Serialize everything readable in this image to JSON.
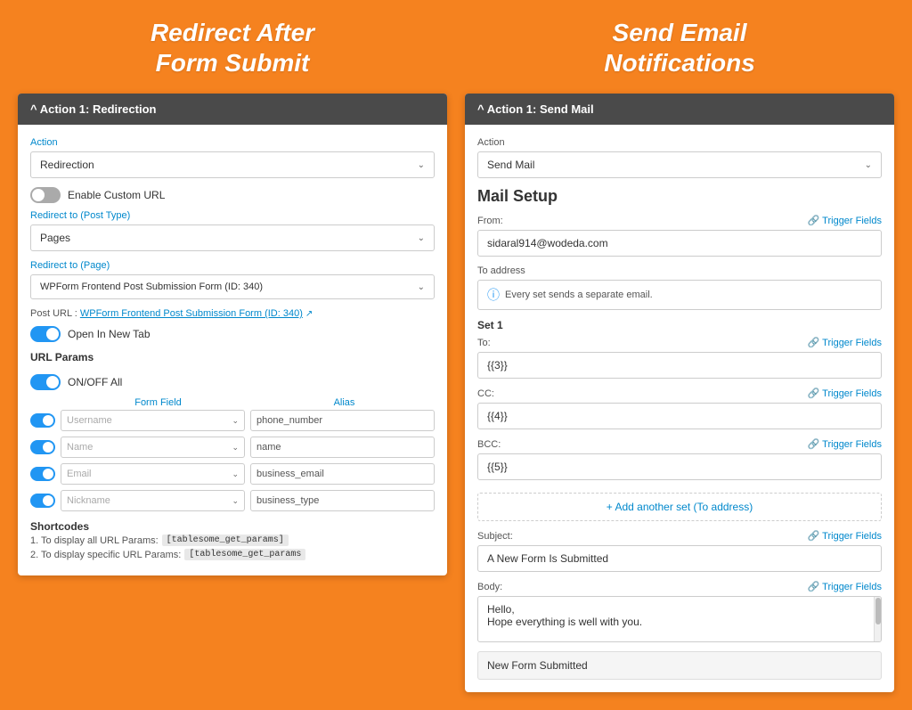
{
  "left": {
    "title_line1": "Redirect After",
    "title_line2": "Form Submit",
    "card_header": "^ Action 1: Redirection",
    "action_label": "Action",
    "action_value": "Redirection",
    "enable_custom_url": "Enable Custom URL",
    "redirect_to_post_type_label": "Redirect to (Post Type)",
    "redirect_to_post_type_value": "Pages",
    "redirect_to_page_label": "Redirect to (Page)",
    "redirect_to_page_value": "WPForm Frontend Post Submission Form (ID: 340)",
    "post_url_label": "Post URL : ",
    "post_url_link": "WPForm Frontend Post Submission Form (ID: 340)",
    "open_in_new_tab": "Open In New Tab",
    "url_params": "URL Params",
    "on_off_all": "ON/OFF All",
    "form_field_header": "Form Field",
    "alias_header": "Alias",
    "rows": [
      {
        "field": "Username",
        "alias": "phone_number",
        "on": true
      },
      {
        "field": "Name",
        "alias": "name",
        "on": true
      },
      {
        "field": "Email",
        "alias": "business_email",
        "on": true
      },
      {
        "field": "Nickname",
        "alias": "business_type",
        "on": true
      }
    ],
    "shortcodes_title": "Shortcodes",
    "shortcodes": [
      {
        "num": "1",
        "text": "To display all URL Params:",
        "code": "[tablesome_get_params]"
      },
      {
        "num": "2",
        "text": "To display specific URL Params:",
        "code": "[tablesome_get_params"
      }
    ]
  },
  "right": {
    "title_line1": "Send Email",
    "title_line2": "Notifications",
    "card_header": "^ Action 1: Send Mail",
    "action_label": "Action",
    "action_value": "Send Mail",
    "mail_setup": "Mail Setup",
    "from_label": "From:",
    "from_value": "sidaral914@wodeda.com",
    "trigger_fields": "Trigger Fields",
    "to_address_label": "To address",
    "info_text": "Every set sends a separate email.",
    "set1_label": "Set 1",
    "to_label": "To:",
    "to_value": "{{3}}",
    "cc_label": "CC:",
    "cc_value": "{{4}}",
    "bcc_label": "BCC:",
    "bcc_value": "{{5}}",
    "add_set_btn": "+ Add another set (To address)",
    "subject_label": "Subject:",
    "subject_value": "A New Form Is Submitted",
    "body_label": "Body:",
    "body_text_line1": "Hello,",
    "body_text_line2": "Hope everything is well with you.",
    "new_form_submitted": "New Form Submitted"
  }
}
